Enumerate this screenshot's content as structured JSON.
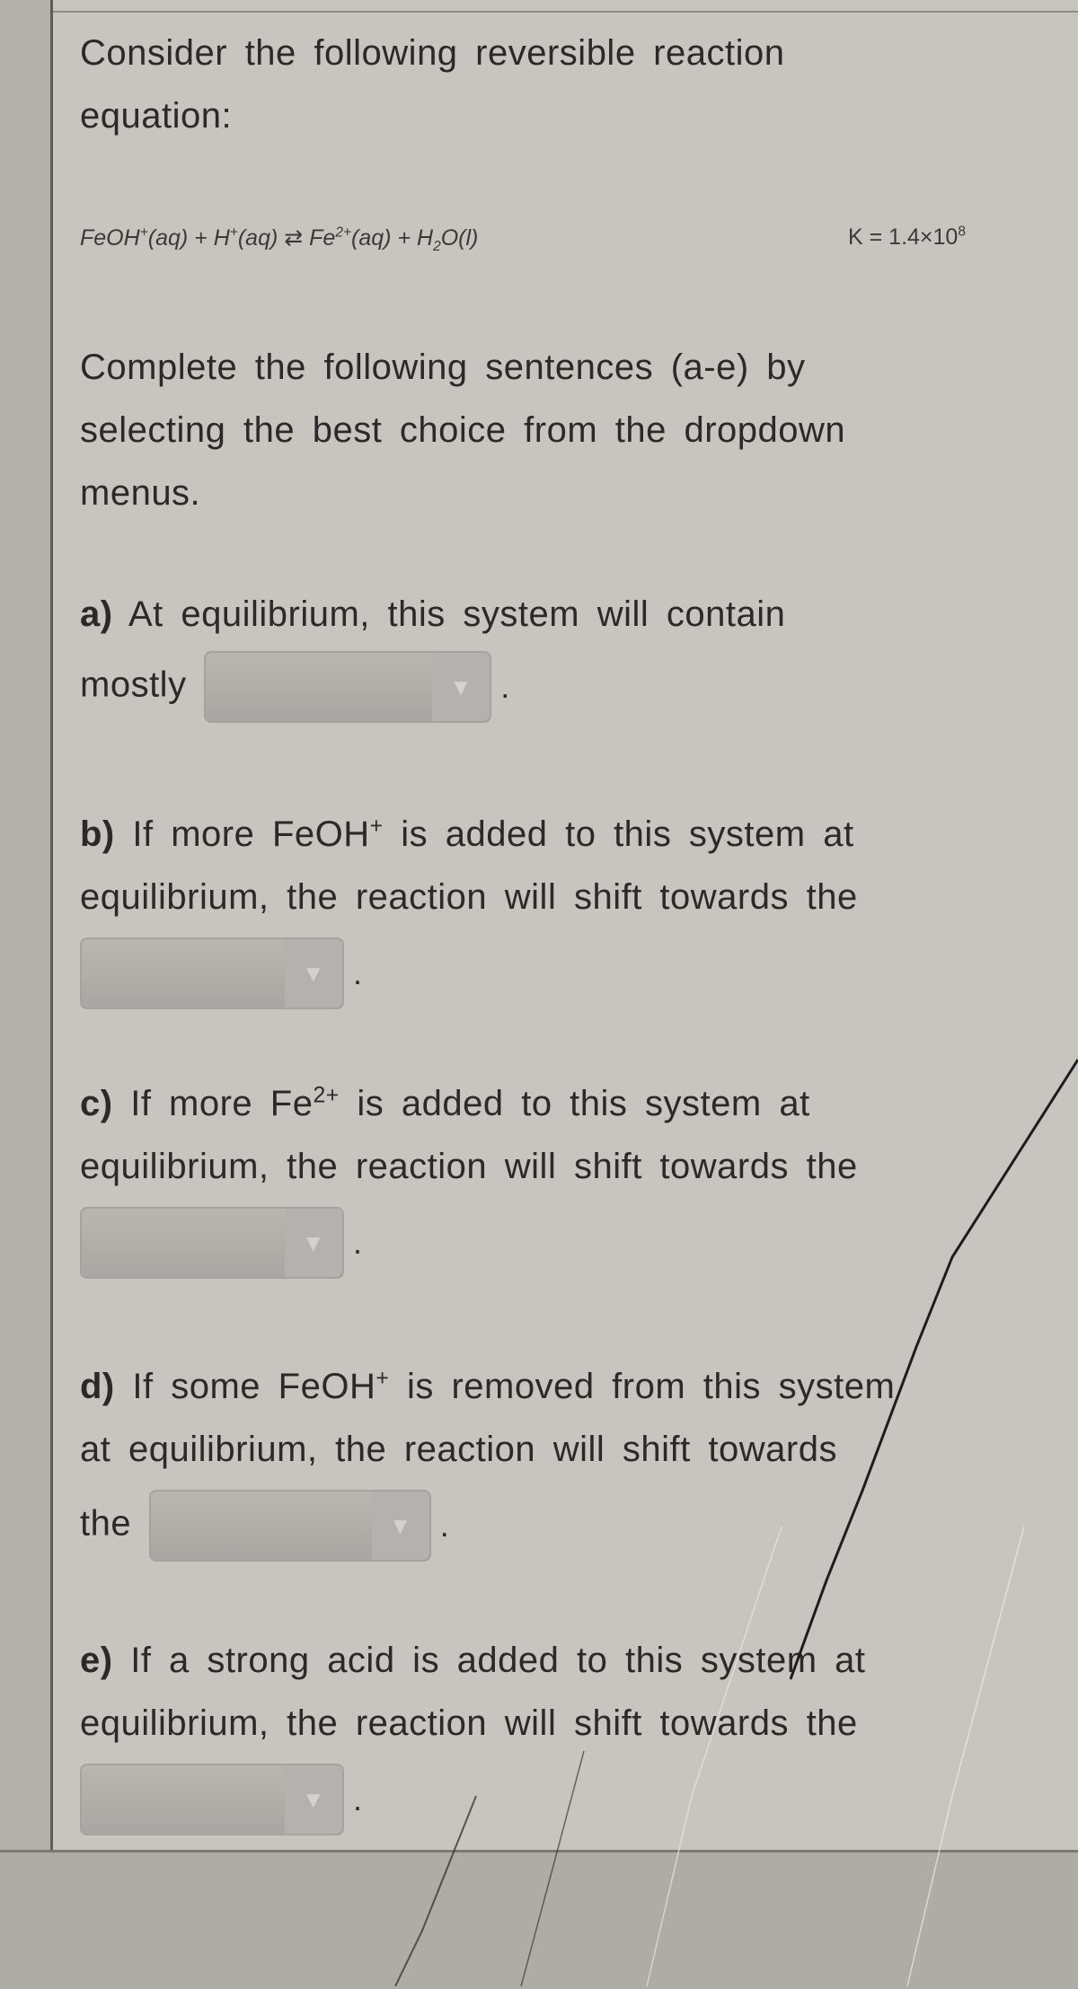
{
  "intro": {
    "line1": "Consider the following reversible reaction",
    "line2": "equation:"
  },
  "equation": {
    "reactant1": "FeOH",
    "reactant1_charge": "+",
    "reactant1_state": "(aq)",
    "plus1": " + ",
    "reactant2": "H",
    "reactant2_charge": "+",
    "reactant2_state": "(aq)",
    "arrow": " ⇄ ",
    "product1": "Fe",
    "product1_charge": "2+",
    "product1_state": "(aq)",
    "plus2": " + ",
    "product2_a": "H",
    "product2_sub": "2",
    "product2_b": "O(l)",
    "k_label": "K = 1.4×10",
    "k_exp": "8"
  },
  "instructions": {
    "line1": "Complete the following sentences (a-e) by",
    "line2": "selecting the best choice from the dropdown",
    "line3": "menus."
  },
  "questions": [
    {
      "label": "a)",
      "line1": "At equilibrium, this system will contain",
      "line2_prefix": "mostly",
      "dropdown_value": "",
      "suffix": "."
    },
    {
      "label": "b)",
      "line1_pre": "If more FeOH",
      "line1_sup": "+",
      "line1_post": " is added to this system at",
      "line2": "equilibrium, the reaction will shift towards the",
      "dropdown_value": "",
      "suffix": "."
    },
    {
      "label": "c)",
      "line1_pre": "If more Fe",
      "line1_sup": "2+",
      "line1_post": " is added to this system at",
      "line2": "equilibrium, the reaction will shift towards the",
      "dropdown_value": "",
      "suffix": "."
    },
    {
      "label": "d)",
      "line1_pre": "If some FeOH",
      "line1_sup": "+",
      "line1_post": " is removed from this system",
      "line2": "at equilibrium, the reaction will shift towards",
      "line3_prefix": "the",
      "dropdown_value": "",
      "suffix": "."
    },
    {
      "label": "e)",
      "line1": "If a strong acid is added to this system at",
      "line2": "equilibrium, the reaction will shift towards the",
      "dropdown_value": "",
      "suffix": "."
    }
  ],
  "icons": {
    "dropdown_arrow": "▼"
  }
}
